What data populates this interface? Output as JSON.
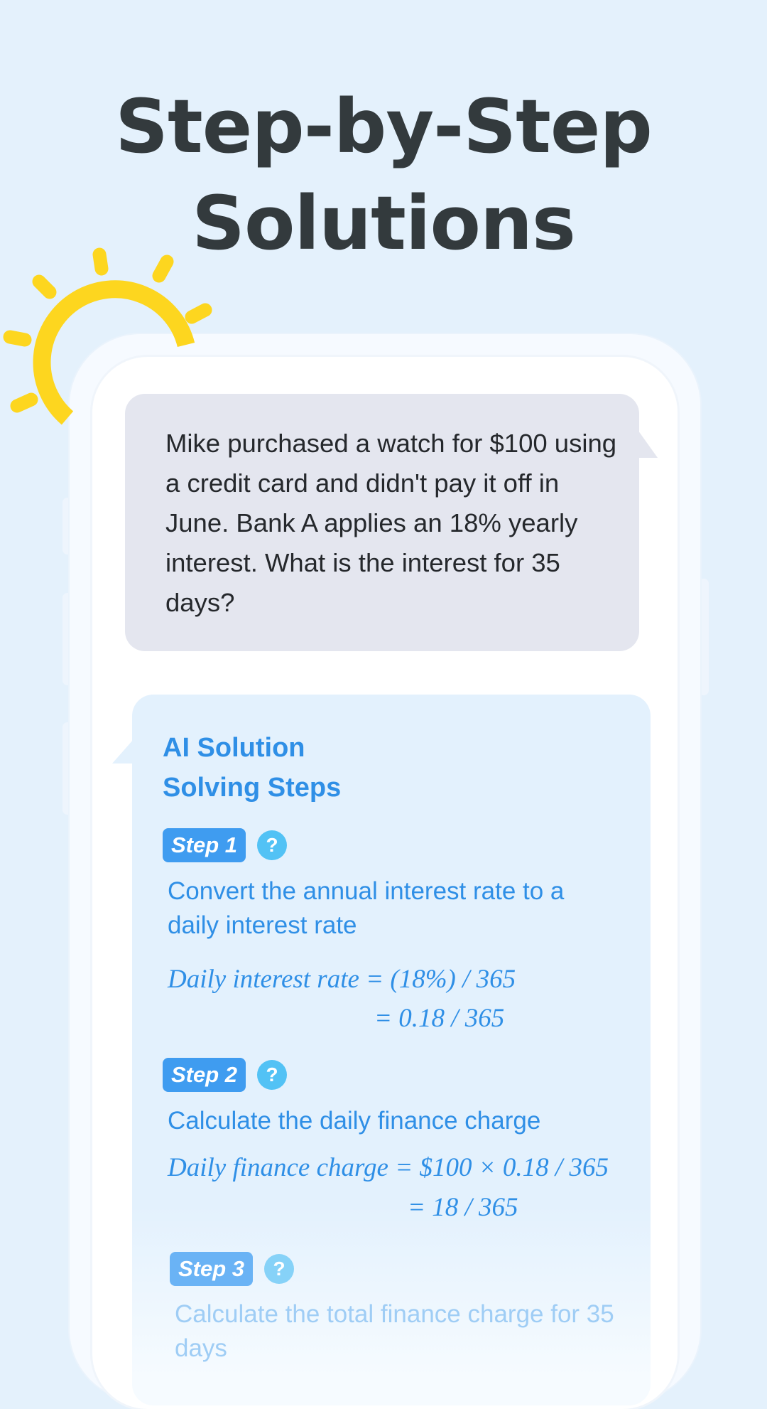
{
  "headline": {
    "line1": "Step-by-Step",
    "line2": "Solutions"
  },
  "question": {
    "text": "Mike purchased a watch for $100 using a credit card and didn't pay it off in June. Bank A applies an 18% yearly interest. What is the interest for 35 days?"
  },
  "answer": {
    "title_line1": "AI Solution",
    "title_line2": "Solving Steps",
    "help_icon_glyph": "?",
    "steps": [
      {
        "label": "Step 1",
        "description": "Convert the annual interest rate to a daily interest rate",
        "formula_line1": "Daily interest rate = (18%) / 365",
        "formula_line2": "= 0.18 / 365"
      },
      {
        "label": "Step 2",
        "description": "Calculate the daily finance charge",
        "formula_line1": "Daily finance charge = $100 × 0.18 / 365",
        "formula_line2": "= 18 / 365"
      },
      {
        "label": "Step 3",
        "description": "Calculate the total finance charge for 35 days"
      }
    ]
  },
  "colors": {
    "background": "#e4f1fc",
    "headline": "#333a3d",
    "accent_blue": "#2f8fe6",
    "badge_blue": "#3f9cf0",
    "help_icon": "#52c2f5",
    "sun": "#fdd61f",
    "question_bubble": "#e4e6ef"
  },
  "icons": {
    "sun": "sun-icon",
    "help": "question-mark-icon"
  }
}
